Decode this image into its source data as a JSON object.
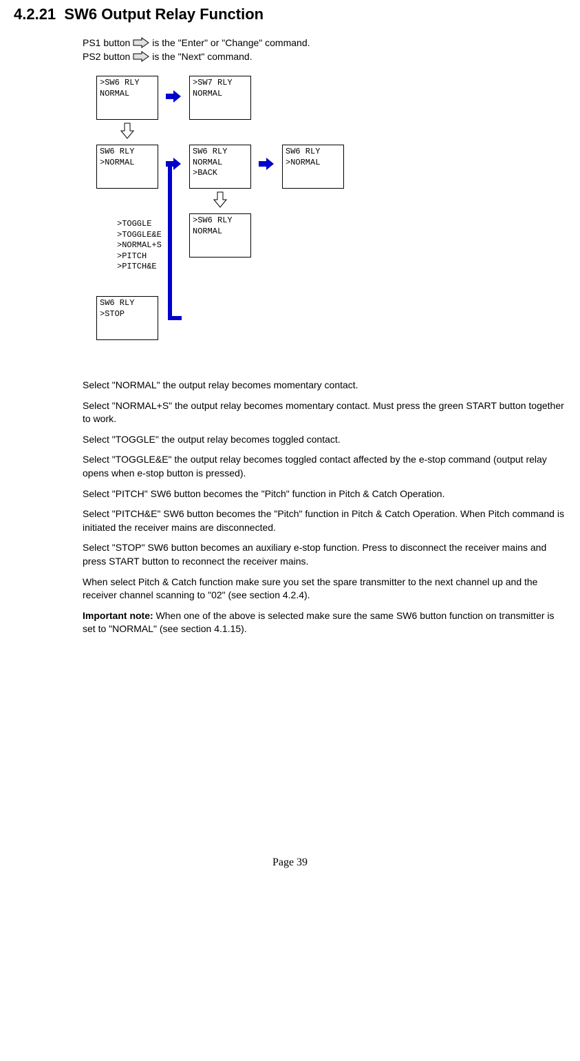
{
  "header": {
    "section_num": "4.2.21",
    "title": "SW6 Output Relay Function"
  },
  "intro": {
    "line1_a": "PS1 button",
    "line1_b": "is the \"Enter\" or \"Change\" command.",
    "line2_a": "PS2 button",
    "line2_b": "is the \"Next\" command."
  },
  "screens": {
    "s1_l1": ">SW6   RLY",
    "s1_l2": " NORMAL",
    "s2_l1": ">SW7  RLY",
    "s2_l2": " NORMAL",
    "s3_l1": " SW6   RLY",
    "s3_l2": ">NORMAL",
    "s4_l1": " SW6   RLY",
    "s4_l2": " NORMAL",
    "s4_l3": ">BACK",
    "s5_l1": " SW6   RLY",
    "s5_l2": ">NORMAL",
    "s6_l1": ">SW6   RLY",
    "s6_l2": " NORMAL",
    "s7_l1": " SW6   RLY",
    "s7_l2": ">STOP"
  },
  "options": {
    "o1": ">TOGGLE",
    "o2": ">TOGGLE&E",
    "o3": ">NORMAL+S",
    "o4": ">PITCH",
    "o5": ">PITCH&E"
  },
  "body": {
    "p1": "Select \"NORMAL\" the output relay becomes momentary contact.",
    "p2": "Select \"NORMAL+S\" the output relay becomes momentary contact. Must press the green START button together to work.",
    "p3": "Select \"TOGGLE\" the output relay becomes toggled contact.",
    "p4": "Select \"TOGGLE&E\" the output relay becomes toggled contact affected by the e-stop command (output relay opens when e-stop button is pressed).",
    "p5": "Select \"PITCH\" SW6 button becomes the \"Pitch\" function in Pitch & Catch Operation.",
    "p6": "Select \"PITCH&E\" SW6 button becomes the \"Pitch\" function in Pitch & Catch Operation. When Pitch command is initiated the receiver mains are disconnected.",
    "p7": "Select \"STOP\" SW6 button becomes an auxiliary e-stop function.  Press to disconnect the receiver mains and press START button to reconnect the receiver mains.",
    "p8": "When select Pitch & Catch function make sure you set the spare transmitter to the next channel up and the receiver channel scanning to \"02\" (see section 4.2.4).",
    "p9a": "Important note:",
    "p9b": " When one of the above is selected make sure the same SW6 button function on transmitter is set to \"NORMAL\" (see section 4.1.15)."
  },
  "footer": {
    "page": "Page 39"
  }
}
